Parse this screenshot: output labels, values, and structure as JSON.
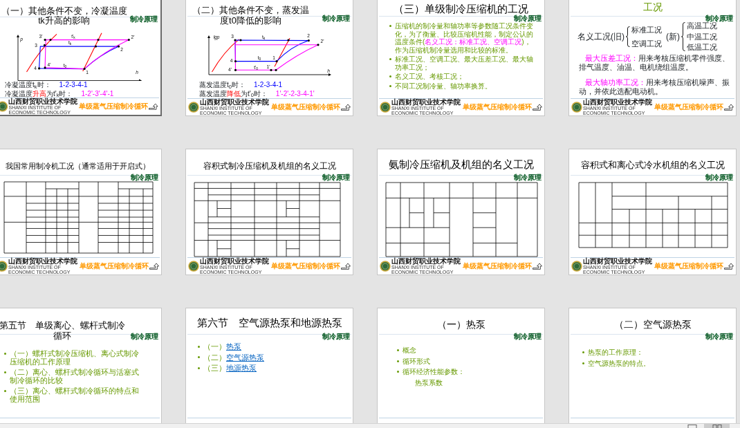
{
  "slides": [
    {
      "kind": "diagram",
      "selected": true,
      "title": "（一）其他条件不变，冷凝温度tk升高的影响",
      "brand": "制冷原理",
      "diagram": {
        "axis_labels": [
          "p",
          "h"
        ],
        "labels": [
          "3'",
          "t'$_{k}$",
          "2'",
          "3",
          "t$_{k}$",
          "2",
          "4'",
          "t$_{0}$",
          "4",
          "1"
        ]
      },
      "captions": [
        {
          "label": [
            {
              "text": "冷凝温度t$_{k}$时：",
              "emphasis": false
            }
          ],
          "path": "1-2-3-4-1",
          "color": "#0000ff"
        },
        {
          "label": [
            {
              "text": "冷凝温度",
              "emphasis": false
            },
            {
              "text": "升高",
              "emphasis": true
            },
            {
              "text": "为t'$_{k}$时：",
              "emphasis": false
            }
          ],
          "path": "1-2'-3'-4'-1",
          "color": "#ff00ff"
        }
      ],
      "footer": {
        "school": "山西财贸职业技术学院",
        "school_en": "SHANXI INSTITUTE OF ECONOMIC TECHNOLOGY",
        "topic": "单级蒸气压缩制冷循环"
      }
    },
    {
      "kind": "diagram",
      "selected": false,
      "title": "（二）其他条件不变，蒸发温度t0降低的影响",
      "brand": "制冷原理",
      "diagram": {
        "axis_labels": [
          "lgp",
          "h"
        ],
        "labels": [
          "3",
          "t$_{k}$",
          "2",
          "2'",
          "4",
          "t$_{0}$",
          "1",
          "4'",
          "t'$_{0}$",
          "1'"
        ]
      },
      "captions": [
        {
          "label": [
            {
              "text": "蒸发温度t$_{0}$时：",
              "emphasis": false
            }
          ],
          "path": "1-2-3-4-1",
          "color": "#0000ff"
        },
        {
          "label": [
            {
              "text": "蒸发温度",
              "emphasis": false
            },
            {
              "text": "降低",
              "emphasis": true
            },
            {
              "text": "为t'$_{0}$时：",
              "emphasis": false
            }
          ],
          "path": "1'-2'-2-3-4-1'",
          "color": "#ff00ff"
        }
      ],
      "footer": {
        "school": "山西财贸职业技术学院",
        "school_en": "SHANXI INSTITUTE OF ECONOMIC TECHNOLOGY",
        "topic": "单级蒸气压缩制冷循环"
      }
    },
    {
      "kind": "bullets",
      "selected": false,
      "title": "（三）单级制冷压缩机的工况",
      "brand": "制冷原理",
      "items": [
        {
          "parts": [
            {
              "text": "压缩机的制冷量和轴功率等参数随工况条件变化，为了衡量、比较压缩机性能，制定公认的温度条件(",
              "emphasis": false
            },
            {
              "text": "名义工况：标准工况、空调工况",
              "emphasis": true
            },
            {
              "text": ")，作为压缩机制冷量选用和比较的标准。",
              "emphasis": false
            }
          ]
        },
        {
          "parts": [
            {
              "text": "标准工况、空调工况、最大压差工况、最大轴功率工况；",
              "emphasis": false
            }
          ]
        },
        {
          "parts": [
            {
              "text": "名义工况、考核工况；",
              "emphasis": false
            }
          ]
        },
        {
          "parts": [
            {
              "text": "不同工况制冷量、轴功率换算。",
              "emphasis": false
            }
          ]
        }
      ],
      "footer": {
        "school": "山西财贸职业技术学院",
        "school_en": "SHANXI INSTITUTE OF ECONOMIC TECHNOLOGY",
        "topic": "单级蒸气压缩制冷循环"
      }
    },
    {
      "kind": "conditions",
      "selected": false,
      "title": "工况",
      "brand": "制冷原理",
      "nominal": {
        "label": "名义工况(旧)",
        "old_items": [
          "标准工况",
          "空调工况"
        ],
        "new_label": "(新)",
        "new_items": [
          "高温工况",
          "中温工况",
          "低温工况"
        ]
      },
      "notes": [
        {
          "term": "最大压差工况：",
          "text": "用来考核压缩机零件强度、排气温度、油温、电机绕组温度。"
        },
        {
          "term": "最大轴功率工况：",
          "text": "用来考核压缩机噪声、振动，并依此选配电动机。"
        }
      ],
      "footer": {
        "school": "山西财贸职业技术学院",
        "school_en": "SHANXI INSTITUTE OF ECONOMIC TECHNOLOGY",
        "topic": "单级蒸气压缩制冷循环"
      }
    },
    {
      "kind": "table",
      "selected": false,
      "title": "我国常用制冷机工况（通常适用于开启式）",
      "brand": "制冷原理",
      "footer": {
        "school": "山西财贸职业技术学院",
        "school_en": "SHANXI INSTITUTE OF ECONOMIC TECHNOLOGY",
        "topic": "单级蒸气压缩制冷循环"
      }
    },
    {
      "kind": "table",
      "selected": false,
      "title": "容积式制冷压缩机及机组的名义工况",
      "brand": "制冷原理",
      "footer": {
        "school": "山西财贸职业技术学院",
        "school_en": "SHANXI INSTITUTE OF ECONOMIC TECHNOLOGY",
        "topic": "单级蒸气压缩制冷循环"
      }
    },
    {
      "kind": "table",
      "selected": false,
      "title": "氨制冷压缩机及机组的名义工况",
      "brand": "制冷原理",
      "footer": {
        "school": "山西财贸职业技术学院",
        "school_en": "SHANXI INSTITUTE OF ECONOMIC TECHNOLOGY",
        "topic": "单级蒸气压缩制冷循环"
      }
    },
    {
      "kind": "table",
      "selected": false,
      "title": "容积式和离心式冷水机组的名义工况",
      "brand": "制冷原理",
      "footer": {
        "school": "山西财贸职业技术学院",
        "school_en": "SHANXI INSTITUTE OF ECONOMIC TECHNOLOGY",
        "topic": "单级蒸气压缩制冷循环"
      }
    },
    {
      "kind": "bullets",
      "selected": false,
      "title": "第五节　单级离心、螺杆式制冷循环",
      "brand": "制冷原理",
      "items": [
        {
          "text": "（一）螺杆式制冷压缩机、离心式制冷压缩机的工作原理"
        },
        {
          "text": "（二）离心、螺杆式制冷循环与活塞式制冷循环的比较"
        },
        {
          "text": "（三）离心、螺杆式制冷循环的特点和使用范围"
        }
      ]
    },
    {
      "kind": "bullets",
      "selected": false,
      "title": "第六节　空气源热泵和地源热泵",
      "brand": "制冷原理",
      "items": [
        {
          "parts": [
            {
              "text": "（一）",
              "link": false
            },
            {
              "text": "热泵",
              "link": true
            }
          ]
        },
        {
          "parts": [
            {
              "text": "（二）",
              "link": false
            },
            {
              "text": "空气源热泵",
              "link": true
            }
          ]
        },
        {
          "parts": [
            {
              "text": "（三）",
              "link": false
            },
            {
              "text": "地源热泵",
              "link": true
            }
          ]
        }
      ]
    },
    {
      "kind": "bullets",
      "selected": false,
      "title": "（一）热泵",
      "brand": "制冷原理",
      "items": [
        {
          "text": "概念"
        },
        {
          "text": "循环形式"
        },
        {
          "text": "循环经济性能参数：",
          "children": [
            {
              "text": "热泵系数"
            }
          ]
        }
      ]
    },
    {
      "kind": "bullets",
      "selected": false,
      "title": "（二）空气源热泵",
      "brand": "制冷原理",
      "items": [
        {
          "text": "热泵的工作原理："
        },
        {
          "text": "空气源热泵的特点。"
        }
      ]
    }
  ],
  "status_bar": {
    "views": [
      {
        "kind": "normal",
        "selected": false
      },
      {
        "kind": "sorter",
        "selected": true
      }
    ]
  }
}
